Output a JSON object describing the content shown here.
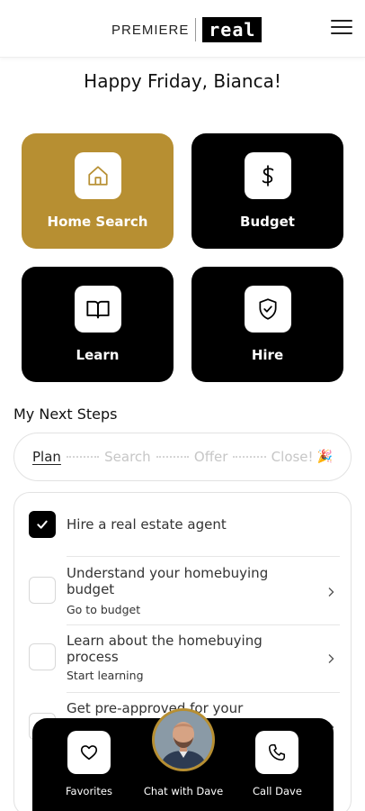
{
  "header": {
    "brand_left": "PREMIERE",
    "brand_right": "real",
    "menu_icon": "hamburger-menu-icon"
  },
  "greeting": "Happy Friday, Bianca!",
  "tiles": [
    {
      "label": "Home Search",
      "icon": "home-icon",
      "active": true
    },
    {
      "label": "Budget",
      "icon": "dollar-icon",
      "active": false
    },
    {
      "label": "Learn",
      "icon": "book-icon",
      "active": false
    },
    {
      "label": "Hire",
      "icon": "shield-check-icon",
      "active": false
    }
  ],
  "next_steps": {
    "title": "My Next Steps",
    "steps": [
      {
        "label": "Plan",
        "current": true
      },
      {
        "label": "Search",
        "current": false
      },
      {
        "label": "Offer",
        "current": false
      },
      {
        "label": "Close!",
        "current": false
      }
    ],
    "celebration_emoji": "🎉"
  },
  "tasks": [
    {
      "title": "Hire a real estate agent",
      "subtitle": "",
      "checked": true
    },
    {
      "title": "Understand your homebuying budget",
      "subtitle": "Go to budget",
      "checked": false
    },
    {
      "title": "Learn about the homebuying process",
      "subtitle": "Start learning",
      "checked": false
    },
    {
      "title": "Get pre-approved for your",
      "subtitle": "",
      "checked": false
    }
  ],
  "bottom_bar": {
    "favorites": "Favorites",
    "chat": "Chat with Dave",
    "call": "Call Dave"
  },
  "colors": {
    "accent_gold": "#b78f32",
    "tile_dark": "#000000"
  }
}
